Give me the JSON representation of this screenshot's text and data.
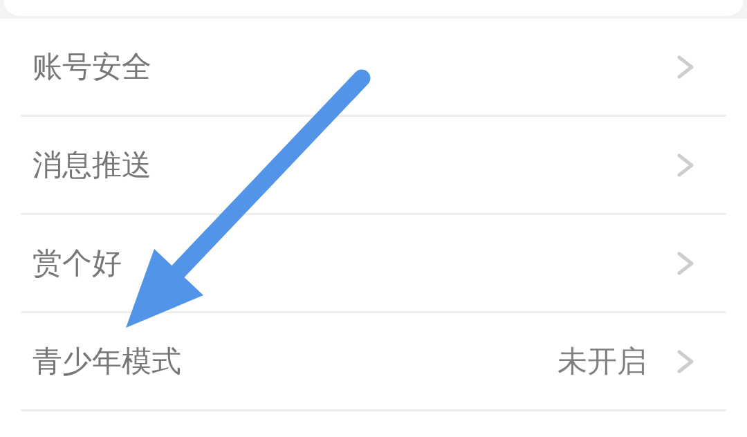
{
  "settings": {
    "items": [
      {
        "label": "账号安全"
      },
      {
        "label": "消息推送"
      },
      {
        "label": "赏个好"
      },
      {
        "label": "青少年模式",
        "value": "未开启"
      }
    ]
  }
}
